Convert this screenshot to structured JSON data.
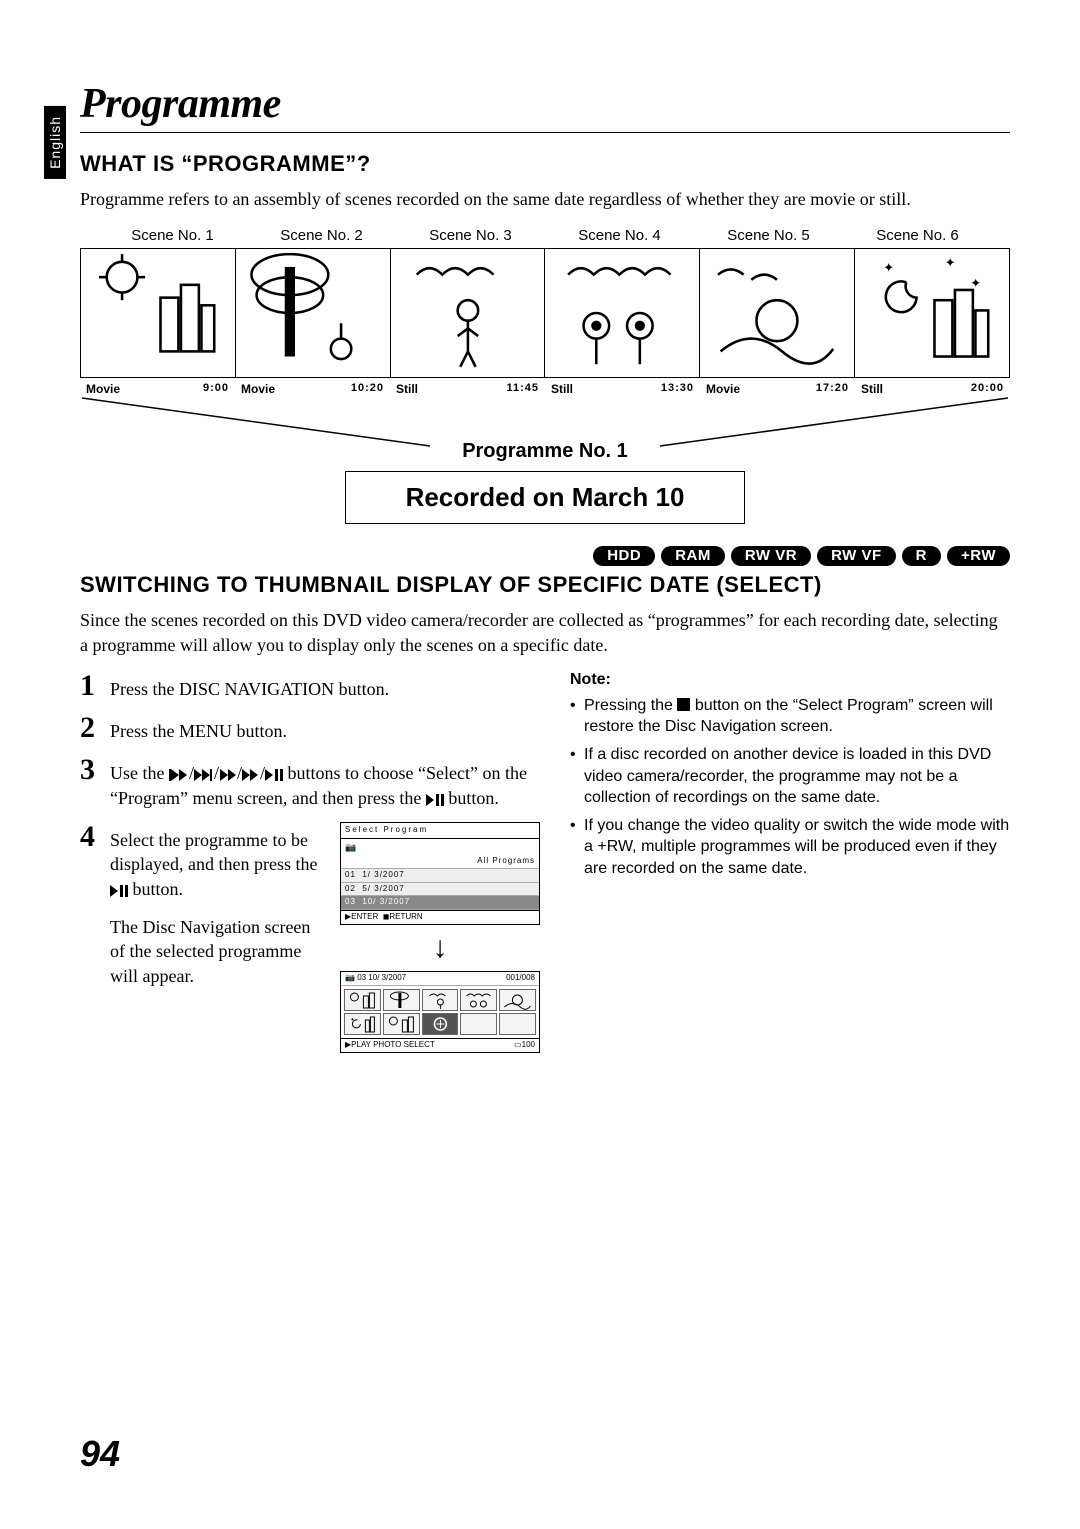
{
  "language_tab": "English",
  "title": "Programme",
  "h2_1": "WHAT IS “PROGRAMME”?",
  "intro": "Programme refers to an assembly of scenes recorded on the same date regardless of whether they are movie or still.",
  "scene_labels": [
    "Scene No. 1",
    "Scene No. 2",
    "Scene No. 3",
    "Scene No. 4",
    "Scene No. 5",
    "Scene No. 6"
  ],
  "time_row": [
    {
      "type": "Movie",
      "time": "9:00"
    },
    {
      "type": "Movie",
      "time": "10:20"
    },
    {
      "type": "Still",
      "time": "11:45"
    },
    {
      "type": "Still",
      "time": "13:30"
    },
    {
      "type": "Movie",
      "time": "17:20"
    },
    {
      "type": "Still",
      "time": "20:00"
    }
  ],
  "programme_label": "Programme No. 1",
  "recorded_box": "Recorded on March 10",
  "media_pills": [
    "HDD",
    "RAM",
    "RW VR",
    "RW VF",
    "R",
    "+RW"
  ],
  "h2_2": "SWITCHING TO THUMBNAIL DISPLAY OF SPECIFIC DATE (SELECT)",
  "intro2": "Since the scenes recorded on this DVD video camera/recorder are collected as “programmes” for each recording date, selecting a programme will allow you to display only the scenes on a specific date.",
  "steps": {
    "s1": "Press the DISC NAVIGATION button.",
    "s2": "Press the MENU button.",
    "s3_a": "Use the ",
    "s3_b": " buttons to choose “Select” on the “Program” menu screen, and then press the ",
    "s3_c": " button.",
    "s4_a": "Select the programme to be displayed, and then press the ",
    "s4_b": " button.",
    "s4_c": "The Disc Navigation screen of the selected programme will appear."
  },
  "select_program": {
    "header": "Select Program",
    "all": "All Programs",
    "rows": [
      {
        "n": "01",
        "d": "1/ 3/2007"
      },
      {
        "n": "02",
        "d": "5/ 3/2007"
      },
      {
        "n": "03",
        "d": "10/ 3/2007"
      }
    ],
    "footer_enter": "ENTER",
    "footer_return": "RETURN"
  },
  "nav_screen": {
    "info_left": "03 10/ 3/2007",
    "info_right": "001/008",
    "footer": "PLAY PHOTO SELECT",
    "footer_r": "100"
  },
  "note_label": "Note:",
  "notes": [
    {
      "pre": "Pressing the ",
      "post": " button on the “Select Program” screen will restore the Disc Navigation screen.",
      "stop": true
    },
    {
      "text": "If a disc recorded on another device is loaded in this DVD video camera/recorder, the programme may not be a collection of recordings on the same date."
    },
    {
      "text": "If you change the video quality or switch the wide mode with a +RW, multiple programmes will be produced even if they are recorded on the same date."
    }
  ],
  "page_number": "94"
}
